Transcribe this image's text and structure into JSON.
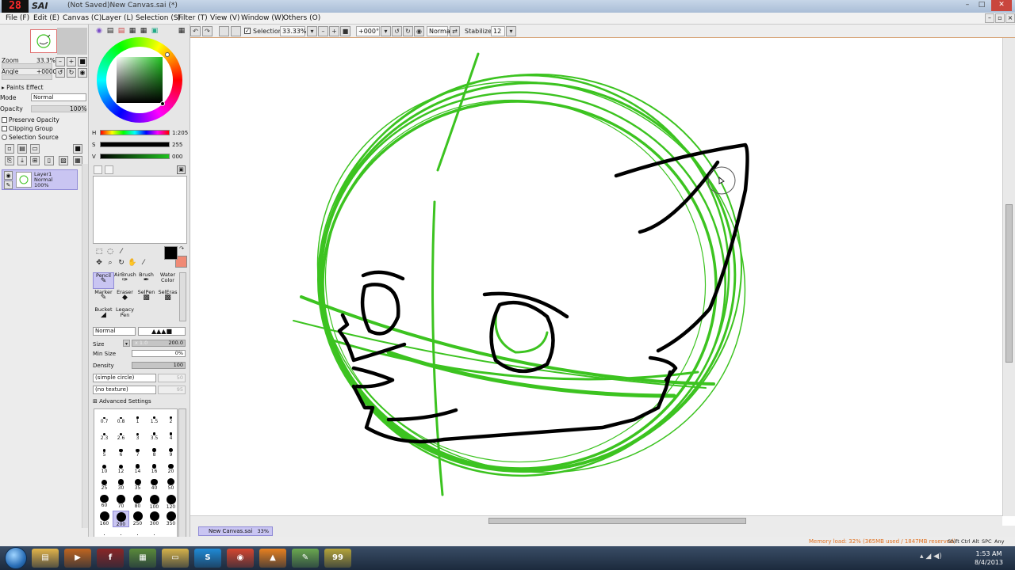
{
  "app": {
    "logo_text": "28",
    "name": "SAI",
    "window_title": "(Not Saved)New Canvas.sai (*)"
  },
  "window_controls": {
    "minimize": "–",
    "maximize": "□",
    "close": "✕"
  },
  "menu": [
    {
      "label": "File (F)"
    },
    {
      "label": "Edit (E)"
    },
    {
      "label": "Canvas (C)"
    },
    {
      "label": "Layer (L)"
    },
    {
      "label": "Selection (S)"
    },
    {
      "label": "Filter (T)"
    },
    {
      "label": "View (V)"
    },
    {
      "label": "Window (W)"
    },
    {
      "label": "Others (O)"
    }
  ],
  "toolbar": {
    "selection_label": "Selection",
    "selection_checked": true,
    "zoom_value": "33.33%",
    "rotation_value": "+000°",
    "blend_mode": "Normal",
    "stabilizer_label": "Stabilizer",
    "stabilizer_value": "12"
  },
  "navigator": {
    "zoom_label": "Zoom",
    "zoom_value": "33.3%",
    "angle_label": "Angle",
    "angle_value": "+0000"
  },
  "layer_panel": {
    "paints_effect_label": "Paints Effect",
    "mode_label": "Mode",
    "mode_value": "Normal",
    "opacity_label": "Opacity",
    "opacity_value": "100%",
    "preserve_opacity": "Preserve Opacity",
    "clipping_group": "Clipping Group",
    "selection_source": "Selection Source",
    "layers": [
      {
        "name": "Layer1",
        "mode": "Normal",
        "opacity": "100%"
      }
    ]
  },
  "color": {
    "h_label": "H",
    "h_value": "1:205",
    "s_label": "S",
    "s_value": "255",
    "v_label": "V",
    "v_value": "000",
    "primary": "#000000",
    "secondary": "#f08a75"
  },
  "tools": {
    "brushes": [
      {
        "label": "Pencil",
        "selected": true
      },
      {
        "label": "AirBrush",
        "selected": false
      },
      {
        "label": "Brush",
        "selected": false
      },
      {
        "label": "Water Color",
        "selected": false
      },
      {
        "label": "Marker",
        "selected": false
      },
      {
        "label": "Eraser",
        "selected": false
      },
      {
        "label": "SelPen",
        "selected": false
      },
      {
        "label": "SelEras",
        "selected": false
      },
      {
        "label": "Bucket",
        "selected": false
      },
      {
        "label": "Legacy Pen",
        "selected": false
      }
    ],
    "brush_mode": "Normal",
    "size_label": "Size",
    "size_multiplier": "x 1.0",
    "size_value": "200.0",
    "min_size_label": "Min Size",
    "min_size_value": "0%",
    "density_label": "Density",
    "density_value": "100",
    "shape": "(simple circle)",
    "shape_value": "50",
    "texture": "(no texture)",
    "texture_value": "95",
    "advanced_label": "Advanced Settings",
    "sizes": [
      "0.7",
      "0.8",
      "1",
      "1.5",
      "2",
      "2.3",
      "2.6",
      "3",
      "3.5",
      "4",
      "5",
      "6",
      "7",
      "8",
      "9",
      "10",
      "12",
      "14",
      "16",
      "20",
      "25",
      "30",
      "35",
      "40",
      "50",
      "60",
      "70",
      "80",
      "100",
      "120",
      "160",
      "200",
      "250",
      "300",
      "350",
      "",
      "",
      "",
      ""
    ],
    "selected_size": "200"
  },
  "document": {
    "tab_label": "New Canvas.sai",
    "tab_zoom": "33%"
  },
  "status": {
    "memory": "Memory load: 32% (365MB used / 1847MB reserved)",
    "keys": [
      "Shift",
      "Ctrl",
      "Alt",
      "SPC",
      "Any"
    ]
  },
  "taskbar": {
    "time": "1:53 AM",
    "date": "8/4/2013",
    "apps": [
      {
        "name": "explorer",
        "color": "#e3b44a",
        "glyph": "▤"
      },
      {
        "name": "media",
        "color": "#c0651f",
        "glyph": "▶"
      },
      {
        "name": "flash",
        "color": "#8a2626",
        "glyph": "f"
      },
      {
        "name": "minecraft",
        "color": "#5a8a3a",
        "glyph": "▦"
      },
      {
        "name": "folder",
        "color": "#d6b24a",
        "glyph": "▭"
      },
      {
        "name": "skype",
        "color": "#1f8ad6",
        "glyph": "S"
      },
      {
        "name": "chrome",
        "color": "#d6462f",
        "glyph": "◉"
      },
      {
        "name": "vlc",
        "color": "#e8801f",
        "glyph": "▲"
      },
      {
        "name": "sai",
        "color": "#6aa84f",
        "glyph": "✎"
      },
      {
        "name": "fraps",
        "color": "#b5a43a",
        "glyph": "99"
      }
    ]
  }
}
